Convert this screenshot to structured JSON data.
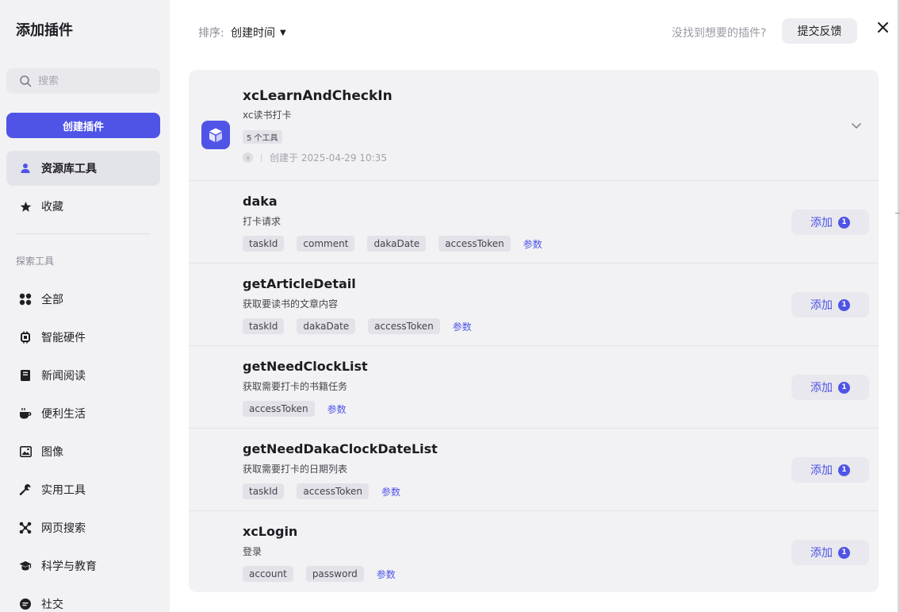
{
  "sidebar": {
    "title": "添加插件",
    "search_placeholder": "搜索",
    "create_button": "创建插件",
    "primary_items": [
      {
        "label": "资源库工具",
        "icon": "user-icon",
        "active": true
      },
      {
        "label": "收藏",
        "icon": "star-icon",
        "active": false
      }
    ],
    "section_label": "探索工具",
    "explore_items": [
      {
        "label": "全部",
        "icon": "grid-icon"
      },
      {
        "label": "智能硬件",
        "icon": "chip-icon"
      },
      {
        "label": "新闻阅读",
        "icon": "book-icon"
      },
      {
        "label": "便利生活",
        "icon": "coffee-icon"
      },
      {
        "label": "图像",
        "icon": "image-icon"
      },
      {
        "label": "实用工具",
        "icon": "wrench-icon"
      },
      {
        "label": "网页搜索",
        "icon": "network-icon"
      },
      {
        "label": "科学与教育",
        "icon": "graduation-cap-icon"
      },
      {
        "label": "社交",
        "icon": "chat-icon"
      }
    ]
  },
  "topbar": {
    "sort_label": "排序:",
    "sort_value": "创建时间",
    "not_found": "没找到想要的插件?",
    "feedback_button": "提交反馈"
  },
  "plugin": {
    "name": "xcLearnAndCheckIn",
    "description": "xc读书打卡",
    "tool_count": "5 个工具",
    "avatar_text": "a",
    "created": "创建于 2025-04-29 10:35",
    "icon": "cube-icon",
    "accent": "#4f54e6"
  },
  "tools": [
    {
      "name": "daka",
      "description": "打卡请求",
      "params": [
        "taskId",
        "comment",
        "dakaDate",
        "accessToken"
      ],
      "params_link": "参数",
      "add_label": "添加",
      "add_count": "1"
    },
    {
      "name": "getArticleDetail",
      "description": "获取要读书的文章内容",
      "params": [
        "taskId",
        "dakaDate",
        "accessToken"
      ],
      "params_link": "参数",
      "add_label": "添加",
      "add_count": "1"
    },
    {
      "name": "getNeedClockList",
      "description": "获取需要打卡的书籍任务",
      "params": [
        "accessToken"
      ],
      "params_link": "参数",
      "add_label": "添加",
      "add_count": "1"
    },
    {
      "name": "getNeedDakaClockDateList",
      "description": "获取需要打卡的日期列表",
      "params": [
        "taskId",
        "accessToken"
      ],
      "params_link": "参数",
      "add_label": "添加",
      "add_count": "1"
    },
    {
      "name": "xcLogin",
      "description": "登录",
      "params": [
        "account",
        "password"
      ],
      "params_link": "参数",
      "add_label": "添加",
      "add_count": "1"
    }
  ]
}
